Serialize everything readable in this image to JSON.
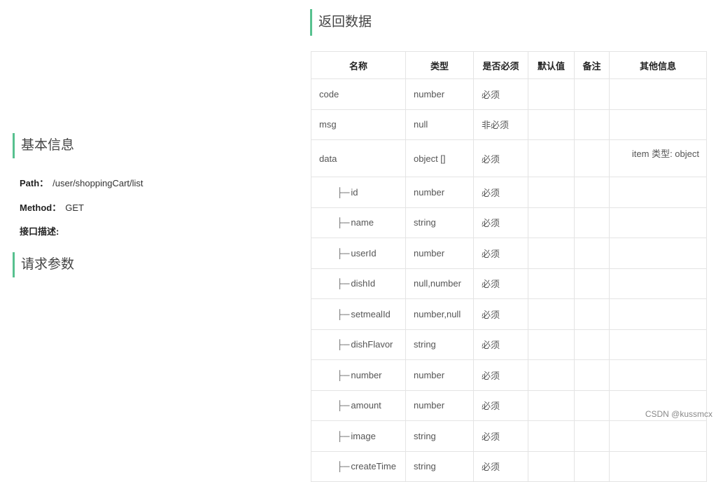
{
  "return_section": {
    "title": "返回数据"
  },
  "basic_section": {
    "title": "基本信息",
    "path_label": "Path：",
    "path_value": "/user/shoppingCart/list",
    "method_label": "Method：",
    "method_value": "GET",
    "desc_label": "接口描述:"
  },
  "request_section": {
    "title": "请求参数"
  },
  "table": {
    "headers": [
      "名称",
      "类型",
      "是否必须",
      "默认值",
      "备注",
      "其他信息"
    ],
    "rows": [
      {
        "name": "code",
        "type": "number",
        "required": "必须",
        "default": "",
        "note": "",
        "other": ""
      },
      {
        "name": "msg",
        "type": "null",
        "required": "非必须",
        "default": "",
        "note": "",
        "other": ""
      },
      {
        "name": "data",
        "type": "object []",
        "required": "必须",
        "default": "",
        "note": "",
        "other": "item 类型: object"
      },
      {
        "name": "id",
        "type": "number",
        "required": "必须",
        "default": "",
        "note": "",
        "other": ""
      },
      {
        "name": "name",
        "type": "string",
        "required": "必须",
        "default": "",
        "note": "",
        "other": ""
      },
      {
        "name": "userId",
        "type": "number",
        "required": "必须",
        "default": "",
        "note": "",
        "other": ""
      },
      {
        "name": "dishId",
        "type": "null,number",
        "required": "必须",
        "default": "",
        "note": "",
        "other": ""
      },
      {
        "name": "setmealId",
        "type": "number,null",
        "required": "必须",
        "default": "",
        "note": "",
        "other": ""
      },
      {
        "name": "dishFlavor",
        "type": "string",
        "required": "必须",
        "default": "",
        "note": "",
        "other": ""
      },
      {
        "name": "number",
        "type": "number",
        "required": "必须",
        "default": "",
        "note": "",
        "other": ""
      },
      {
        "name": "amount",
        "type": "number",
        "required": "必须",
        "default": "",
        "note": "",
        "other": ""
      },
      {
        "name": "image",
        "type": "string",
        "required": "必须",
        "default": "",
        "note": "",
        "other": ""
      },
      {
        "name": "createTime",
        "type": "string",
        "required": "必须",
        "default": "",
        "note": "",
        "other": ""
      }
    ],
    "tree_prefix": "├─"
  },
  "watermark": "CSDN @kussmcx",
  "colors": {
    "accent": "#57c18f"
  }
}
